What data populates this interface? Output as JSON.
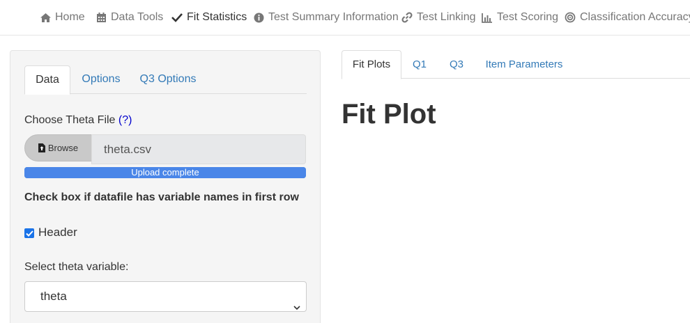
{
  "navbar": {
    "items": [
      {
        "label": "Home",
        "icon": "home-icon",
        "active": false
      },
      {
        "label": "Data Tools",
        "icon": "calendar-icon",
        "active": false
      },
      {
        "label": "Fit Statistics",
        "icon": "check-icon",
        "active": true
      },
      {
        "label": "Test Summary Information",
        "icon": "info-circle-icon",
        "active": false
      },
      {
        "label": "Test Linking",
        "icon": "link-icon",
        "active": false
      },
      {
        "label": "Test Scoring",
        "icon": "bar-chart-icon",
        "active": false
      },
      {
        "label": "Classification Accuracy",
        "icon": "target-icon",
        "active": false
      }
    ]
  },
  "sidebar": {
    "tabs": [
      {
        "label": "Data",
        "active": true
      },
      {
        "label": "Options",
        "active": false
      },
      {
        "label": "Q3 Options",
        "active": false
      }
    ],
    "file_label": "Choose Theta File",
    "help_link": "(?)",
    "browse_label": "Browse",
    "file_name": "theta.csv",
    "progress": {
      "value": 100,
      "text": "Upload complete"
    },
    "header_question": "Check box if datafile has variable names in first row",
    "header_checkbox": {
      "label": "Header",
      "checked": true
    },
    "theta_select_label": "Select theta variable:",
    "theta_select_value": "theta"
  },
  "main": {
    "tabs": [
      {
        "label": "Fit Plots",
        "active": true
      },
      {
        "label": "Q1",
        "active": false
      },
      {
        "label": "Q3",
        "active": false
      },
      {
        "label": "Item Parameters",
        "active": false
      }
    ],
    "title": "Fit Plot"
  },
  "colors": {
    "link": "#337ab7",
    "progress": "#4a86e8",
    "checkbox": "#1a73e8"
  }
}
